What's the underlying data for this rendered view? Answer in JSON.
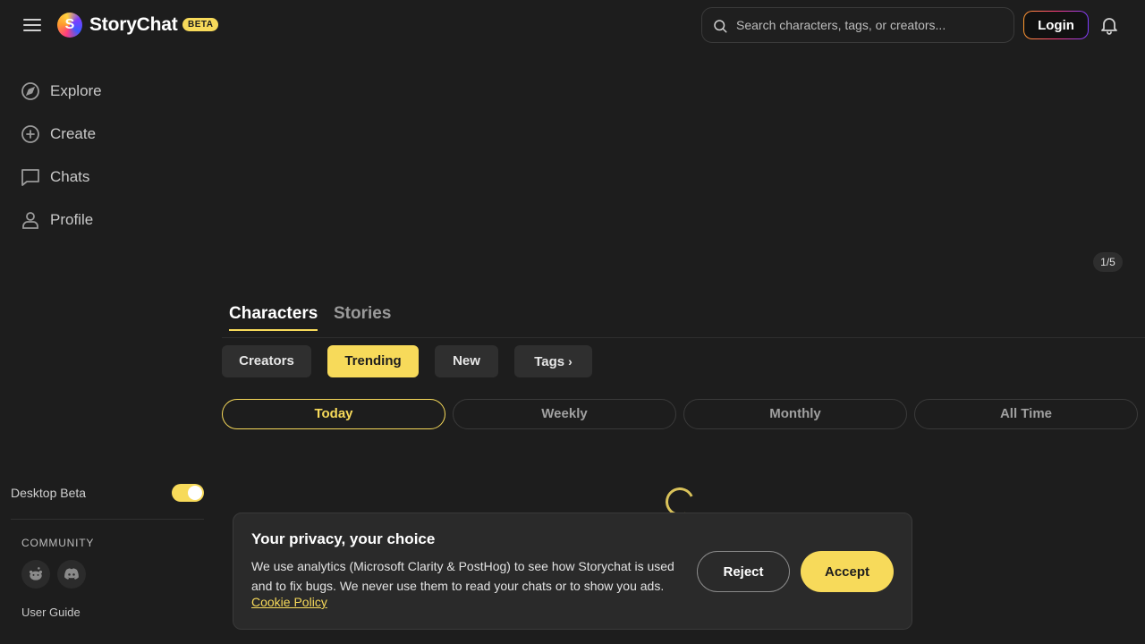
{
  "header": {
    "brand": "StoryChat",
    "beta_badge": "BETA",
    "logo_letter": "S",
    "search_placeholder": "Search characters, tags, or creators...",
    "login_label": "Login"
  },
  "sidebar": {
    "items": [
      {
        "label": "Explore",
        "icon": "compass-icon"
      },
      {
        "label": "Create",
        "icon": "plus-circle-icon"
      },
      {
        "label": "Chats",
        "icon": "chat-bubble-icon"
      },
      {
        "label": "Profile",
        "icon": "user-icon"
      }
    ],
    "desktop_beta_label": "Desktop Beta",
    "desktop_beta_enabled": true,
    "community_label": "COMMUNITY",
    "social": [
      "reddit-icon",
      "discord-icon"
    ],
    "user_guide_label": "User Guide"
  },
  "main": {
    "carousel_indicator": "1/5",
    "tabs": [
      {
        "label": "Characters",
        "active": true
      },
      {
        "label": "Stories",
        "active": false
      }
    ],
    "filters": [
      {
        "label": "Creators",
        "active": false
      },
      {
        "label": "Trending",
        "active": true
      },
      {
        "label": "New",
        "active": false
      },
      {
        "label": "Tags",
        "active": false,
        "chevron": "›"
      }
    ],
    "periods": [
      {
        "label": "Today",
        "active": true
      },
      {
        "label": "Weekly",
        "active": false
      },
      {
        "label": "Monthly",
        "active": false
      },
      {
        "label": "All Time",
        "active": false
      }
    ]
  },
  "cookie_banner": {
    "title": "Your privacy, your choice",
    "body": "We use analytics (Microsoft Clarity & PostHog) to see how Storychat is used and to fix bugs. We never use them to read your chats or to show you ads.",
    "policy_link": "Cookie Policy",
    "reject_label": "Reject",
    "accept_label": "Accept"
  },
  "colors": {
    "background": "#1d1d1d",
    "accent": "#f7da5a",
    "chip": "#2f2f2f"
  }
}
